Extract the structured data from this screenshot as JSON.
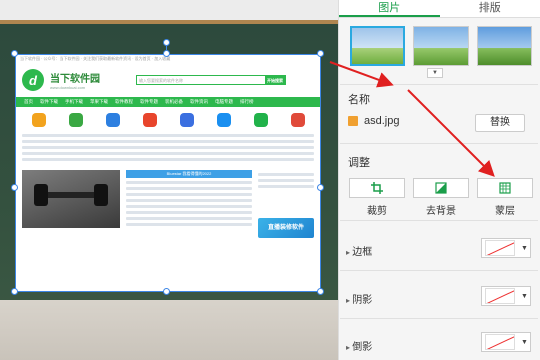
{
  "panel": {
    "tabs": [
      "图片",
      "排版"
    ],
    "active_tab": "图片",
    "name_section": "名称",
    "file_name": "asd.jpg",
    "replace_button": "替换",
    "adjust_section": "调整",
    "tools": [
      "裁剪",
      "去背景",
      "蒙层"
    ],
    "rows": [
      "边框",
      "阴影",
      "倒影"
    ]
  },
  "website": {
    "top_text": "当下软件园 · 公众号：当下软件园 · 关注我们获取最新软件资讯 · 设为首页 · 加入收藏",
    "brand": "当下软件园",
    "domain": "www.downkuai.com",
    "logo_letter": "d",
    "search_placeholder": "输入您要搜索的软件名称",
    "search_button": "开始搜索",
    "nav": [
      "首页",
      "软件下载",
      "手机下载",
      "苹果下载",
      "软件教程",
      "软件专题",
      "装机必备",
      "软件资讯",
      "电脑专题",
      "排行榜"
    ],
    "banner": "Bluestar 我看得懂的2022",
    "ad_text": "直播装修软件"
  },
  "colors": {
    "accent_green": "#1a9e4a",
    "selection_blue": "#3c86e6",
    "arrow_red": "#e02020"
  }
}
